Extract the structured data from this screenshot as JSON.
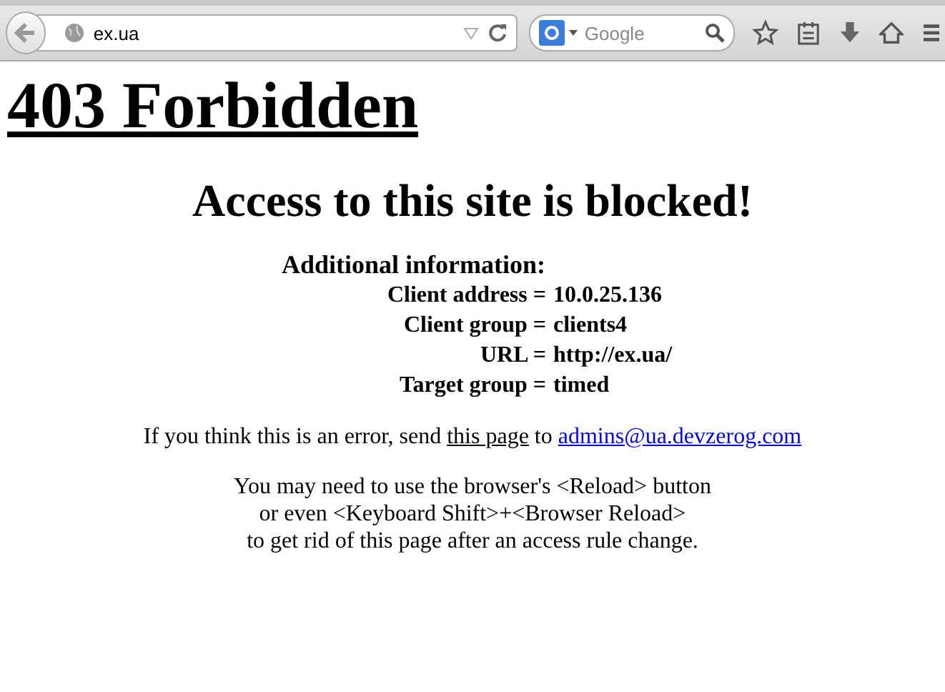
{
  "toolbar": {
    "address": "ex.ua",
    "search_placeholder": "Google"
  },
  "page": {
    "title": "403 Forbidden",
    "heading": "Access to this site is blocked!",
    "info_title": "Additional information:",
    "info_rows": [
      {
        "label": "Client address =",
        "value": "10.0.25.136"
      },
      {
        "label": "Client group =",
        "value": "clients4"
      },
      {
        "label": "URL =",
        "value": "http://ex.ua/"
      },
      {
        "label": "Target group =",
        "value": "timed"
      }
    ],
    "error_line": {
      "before": "If you think this is an error, send",
      "link1": "this page",
      "middle": "to",
      "link2": "admins@ua.devzerog.com"
    },
    "reload_note": [
      "You may need to use the browser's <Reload> button",
      "or even <Keyboard Shift>+<Browser Reload>",
      "to get rid of this page after an access rule change."
    ]
  }
}
